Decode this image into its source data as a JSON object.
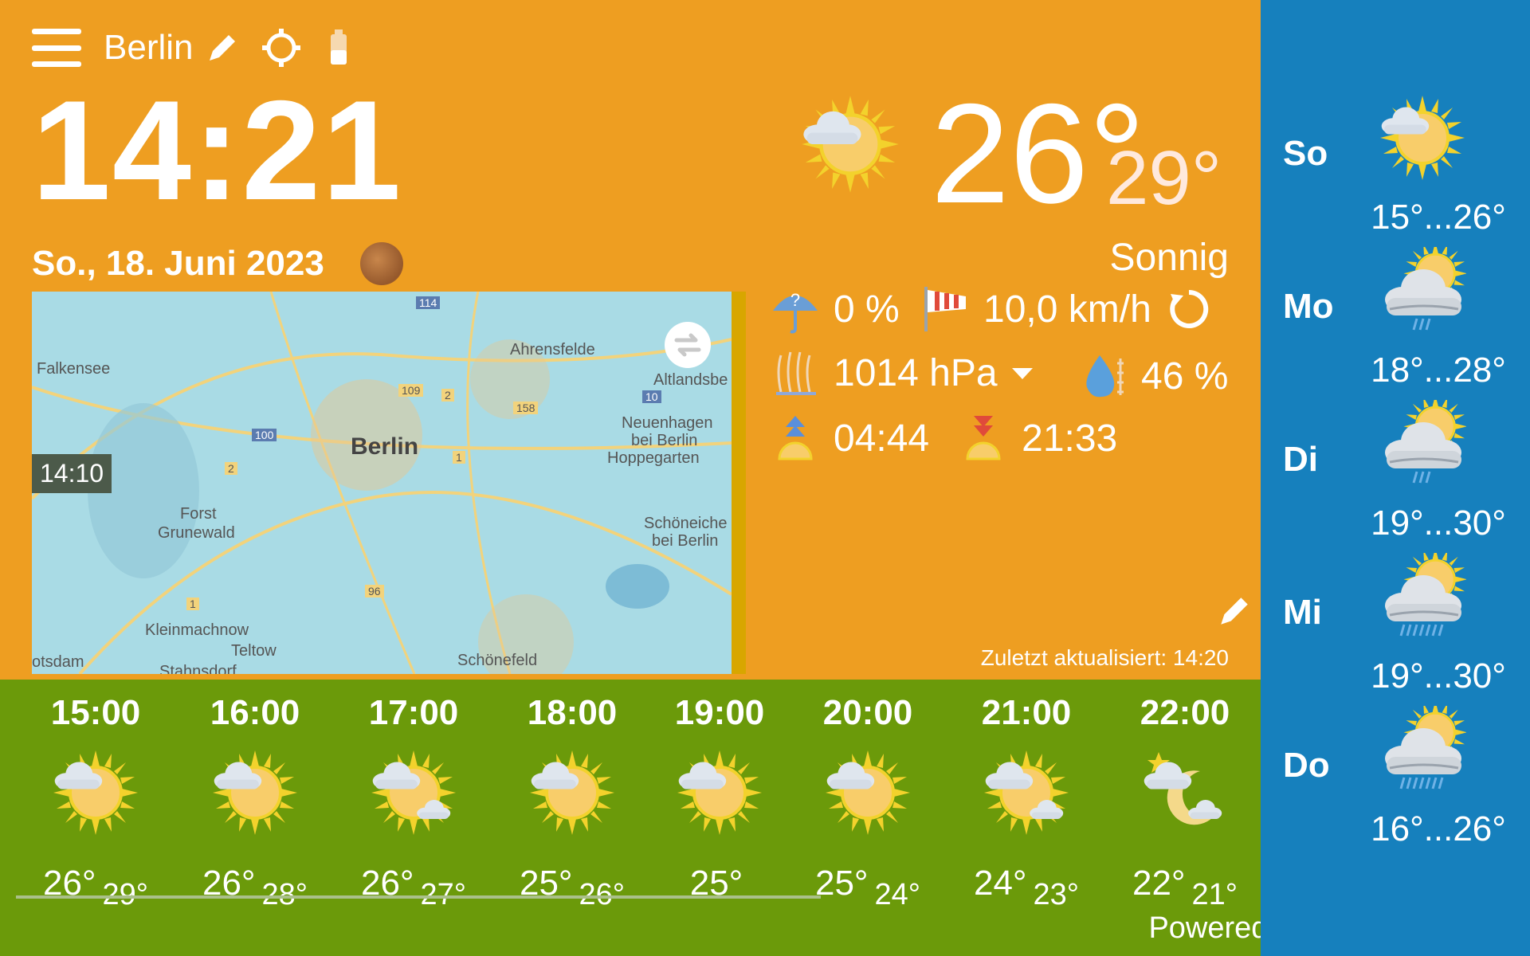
{
  "header": {
    "city": "Berlin"
  },
  "clock": {
    "time": "14:21",
    "date": "So., 18. Juni 2023"
  },
  "map": {
    "time_badge": "14:10",
    "labels": {
      "falkensee": "Falkensee",
      "ahrensfelde": "Ahrensfelde",
      "altlandsberg": "Altlandsbe",
      "berlin": "Berlin",
      "neuenhagen": "Neuenhagen",
      "bei_berlin": "bei Berlin",
      "hoppegarten": "Hoppegarten",
      "forst": "Forst",
      "grunewald": "Grunewald",
      "schoeneiche": "Schöneiche",
      "schoeneiche2": "bei Berlin",
      "kleinmachnow": "Kleinmachnow",
      "teltow": "Teltow",
      "potsdam": "otsdam",
      "stahnsdorf": "Stahnsdorf",
      "schoenefeld": "Schönefeld",
      "r114": "114",
      "r109": "109",
      "r2": "2",
      "r158": "158",
      "r100": "100",
      "r10": "10",
      "r1": "1",
      "r2b": "2",
      "r96": "96",
      "r1b": "1"
    }
  },
  "current": {
    "temp": "26°",
    "feels_like": "29°",
    "condition": "Sonnig",
    "precip": "0 %",
    "wind": "10,0 km/h",
    "pressure": "1014 hPa",
    "humidity": "46 %",
    "sunrise": "04:44",
    "sunset": "21:33",
    "updated": "Zuletzt aktualisiert: 14:20"
  },
  "hourly": [
    {
      "time": "15:00",
      "temp": "26°",
      "feel": "29°",
      "icon": "sun-cloud"
    },
    {
      "time": "16:00",
      "temp": "26°",
      "feel": "28°",
      "icon": "sun-cloud"
    },
    {
      "time": "17:00",
      "temp": "26°",
      "feel": "27°",
      "icon": "sun-clouds"
    },
    {
      "time": "18:00",
      "temp": "25°",
      "feel": "26°",
      "icon": "sun-cloud"
    },
    {
      "time": "19:00",
      "temp": "25°",
      "feel": "",
      "icon": "sun-cloud"
    },
    {
      "time": "20:00",
      "temp": "25°",
      "feel": "24°",
      "icon": "sun-cloud"
    },
    {
      "time": "21:00",
      "temp": "24°",
      "feel": "23°",
      "icon": "sun-clouds"
    },
    {
      "time": "22:00",
      "temp": "22°",
      "feel": "21°",
      "icon": "moon-clouds"
    }
  ],
  "daily": [
    {
      "day": "So",
      "range": "15°...26°",
      "icon": "sun-cloud"
    },
    {
      "day": "Mo",
      "range": "18°...28°",
      "icon": "cloud-rain-light"
    },
    {
      "day": "Di",
      "range": "19°...30°",
      "icon": "cloud-rain-light"
    },
    {
      "day": "Mi",
      "range": "19°...30°",
      "icon": "cloud-rain"
    },
    {
      "day": "Do",
      "range": "16°...26°",
      "icon": "cloud-rain"
    }
  ],
  "footer": {
    "powered": "Powered by AccuWeather"
  },
  "colors": {
    "main": "#ee9e21",
    "hourly": "#6b9a0a",
    "daily": "#1680bd"
  }
}
